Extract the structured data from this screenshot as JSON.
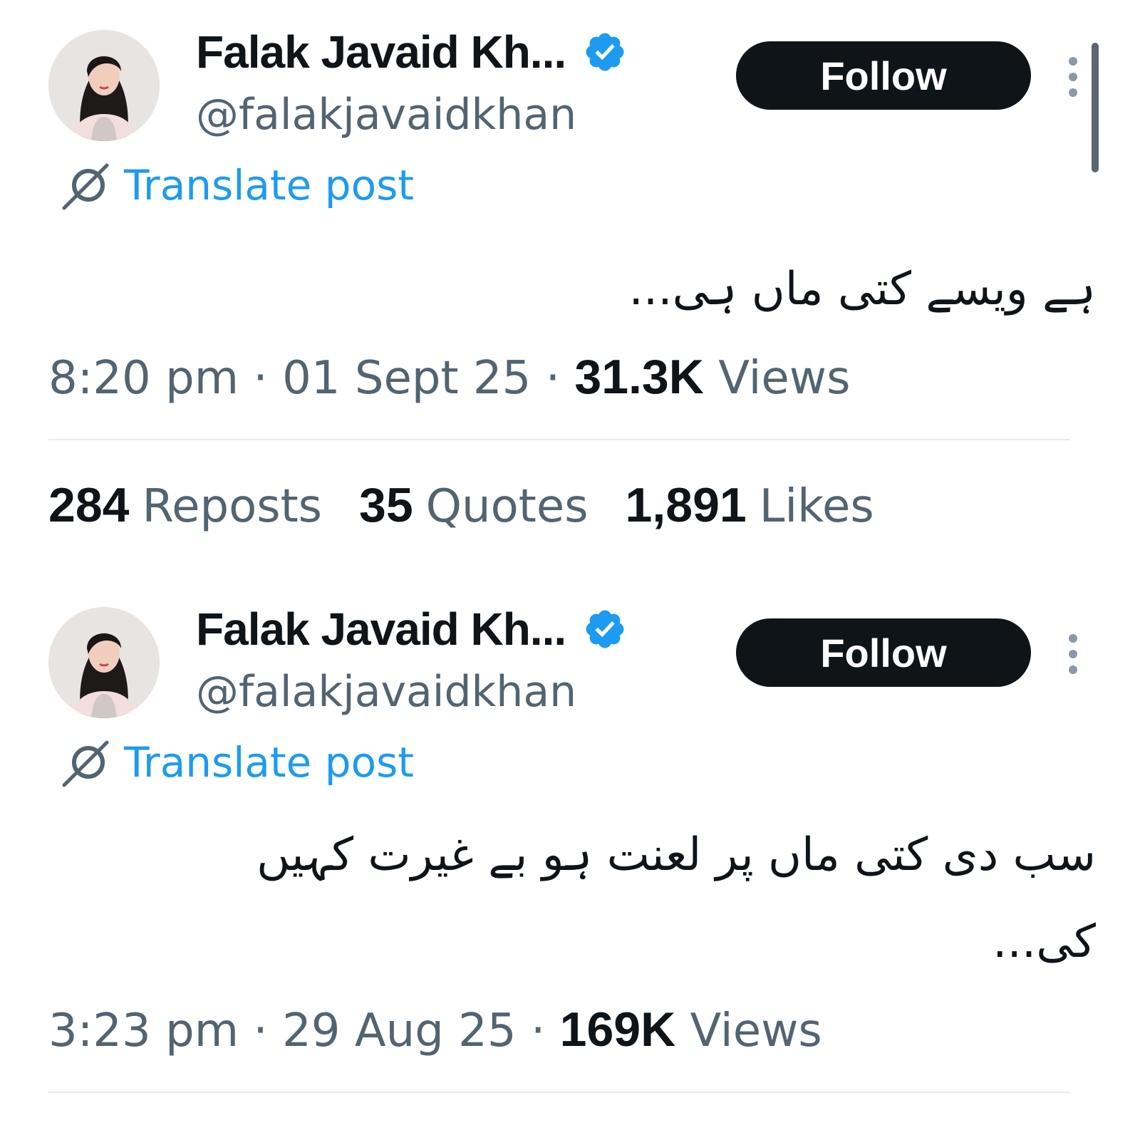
{
  "posts": [
    {
      "author": {
        "display_name": "Falak Javaid Kh...",
        "handle": "@falakjavaidkhan",
        "verified_icon": "verified-badge-icon",
        "badge_color": "#1d9bf0"
      },
      "follow_label": "Follow",
      "translate_label": "Translate post",
      "text": "ہے ویسے کتی ماں ہی...",
      "time": "8:20 pm",
      "date": "01 Sept 25",
      "views_count": "31.3K",
      "views_label": "Views"
    },
    {
      "author": {
        "display_name": "Falak Javaid Kh...",
        "handle": "@falakjavaidkhan",
        "verified_icon": "verified-badge-icon",
        "badge_color": "#1d9bf0"
      },
      "follow_label": "Follow",
      "translate_label": "Translate post",
      "text": "سب دی کتی ماں پر لعنت ہو بے غیرت کہیں کی...",
      "time": "3:23 pm",
      "date": "29 Aug 25",
      "views_count": "169K",
      "views_label": "Views"
    }
  ],
  "engagement": {
    "reposts_count": "284",
    "reposts_label": "Reposts",
    "quotes_count": "35",
    "quotes_label": "Quotes",
    "likes_count": "1,891",
    "likes_label": "Likes"
  },
  "separator": "·",
  "colors": {
    "link": "#1d9bf0",
    "secondary_text": "#536471",
    "primary_text": "#0f1419",
    "button_bg": "#0f1419"
  }
}
